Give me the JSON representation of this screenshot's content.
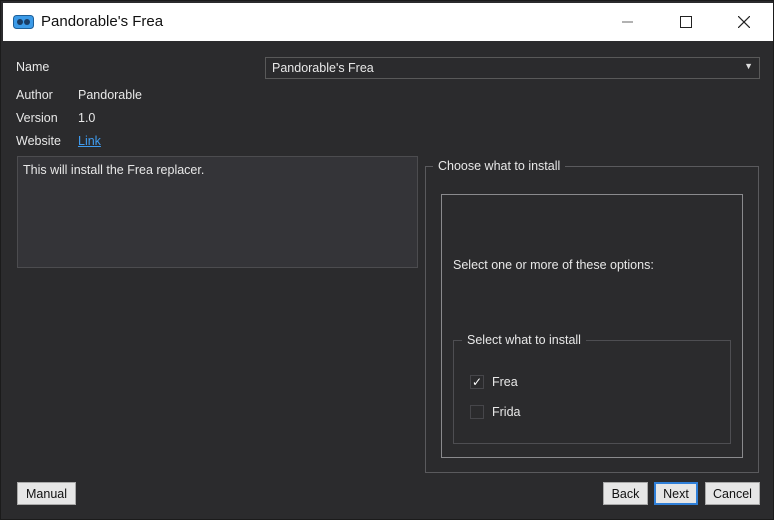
{
  "window": {
    "title": "Pandorable's Frea",
    "accent_icon_color": "#3c9be8"
  },
  "info": {
    "name_label": "Name",
    "author_label": "Author",
    "author_value": "Pandorable",
    "version_label": "Version",
    "version_value": "1.0",
    "website_label": "Website",
    "website_link": "Link"
  },
  "name_select": {
    "selected": "Pandorable's Frea"
  },
  "description": "This will install the Frea replacer.",
  "install_group": {
    "title": "Choose what to install",
    "instruction": "Select one or more of these options:",
    "sub_group_title": "Select what to install",
    "options": [
      {
        "label": "Frea",
        "checked": true,
        "check_mark": "✓"
      },
      {
        "label": "Frida",
        "checked": false,
        "check_mark": ""
      }
    ]
  },
  "buttons": {
    "manual": "Manual",
    "back": "Back",
    "next": "Next",
    "cancel": "Cancel"
  }
}
